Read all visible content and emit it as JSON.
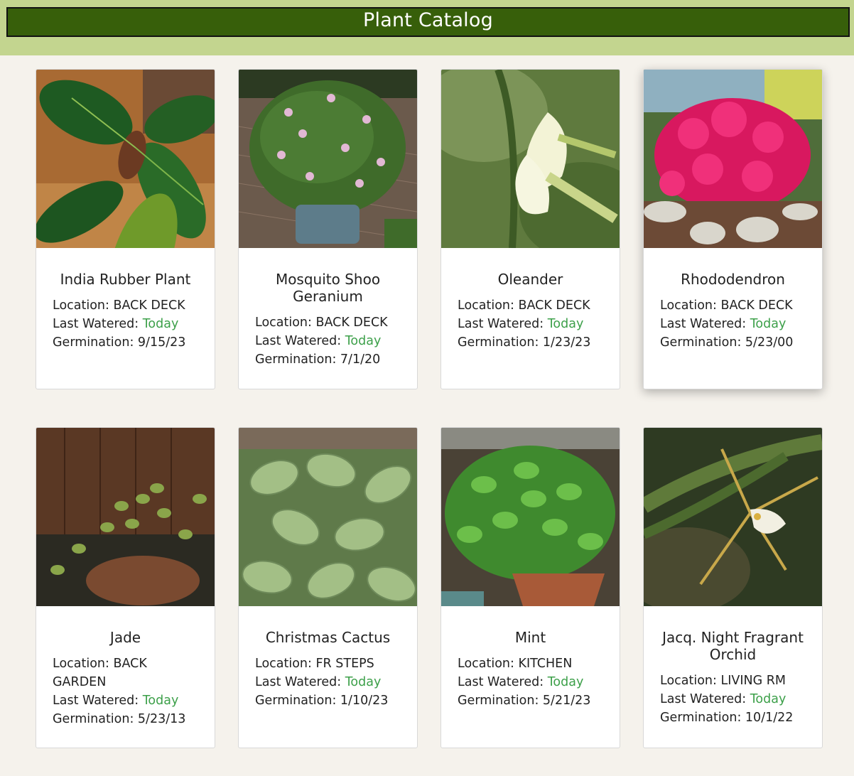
{
  "header": {
    "title": "Plant Catalog"
  },
  "labels": {
    "location": "Location: ",
    "last_watered": "Last Watered: ",
    "germination": "Germination: "
  },
  "colors": {
    "header_bg": "#c3d58f",
    "title_bg": "#375f0a",
    "today": "#3da04a"
  },
  "plants": [
    {
      "name": "India Rubber Plant",
      "location": "BACK DECK",
      "last_watered": "Today",
      "germination": "9/15/23",
      "image": "rubber-plant-photo"
    },
    {
      "name": "Mosquito Shoo Geranium",
      "location": "BACK DECK",
      "last_watered": "Today",
      "germination": "7/1/20",
      "image": "geranium-photo"
    },
    {
      "name": "Oleander",
      "location": "BACK DECK",
      "last_watered": "Today",
      "germination": "1/23/23",
      "image": "oleander-photo"
    },
    {
      "name": "Rhododendron",
      "location": "BACK DECK",
      "last_watered": "Today",
      "germination": "5/23/00",
      "image": "rhododendron-photo"
    },
    {
      "name": "Jade",
      "location": "BACK GARDEN",
      "last_watered": "Today",
      "germination": "5/23/13",
      "image": "jade-photo"
    },
    {
      "name": "Christmas Cactus",
      "location": "FR STEPS",
      "last_watered": "Today",
      "germination": "1/10/23",
      "image": "christmas-cactus-photo"
    },
    {
      "name": "Mint",
      "location": "KITCHEN",
      "last_watered": "Today",
      "germination": "5/21/23",
      "image": "mint-photo"
    },
    {
      "name": "Jacq. Night Fragrant Orchid",
      "location": "LIVING RM",
      "last_watered": "Today",
      "germination": "10/1/22",
      "image": "orchid-photo"
    }
  ]
}
